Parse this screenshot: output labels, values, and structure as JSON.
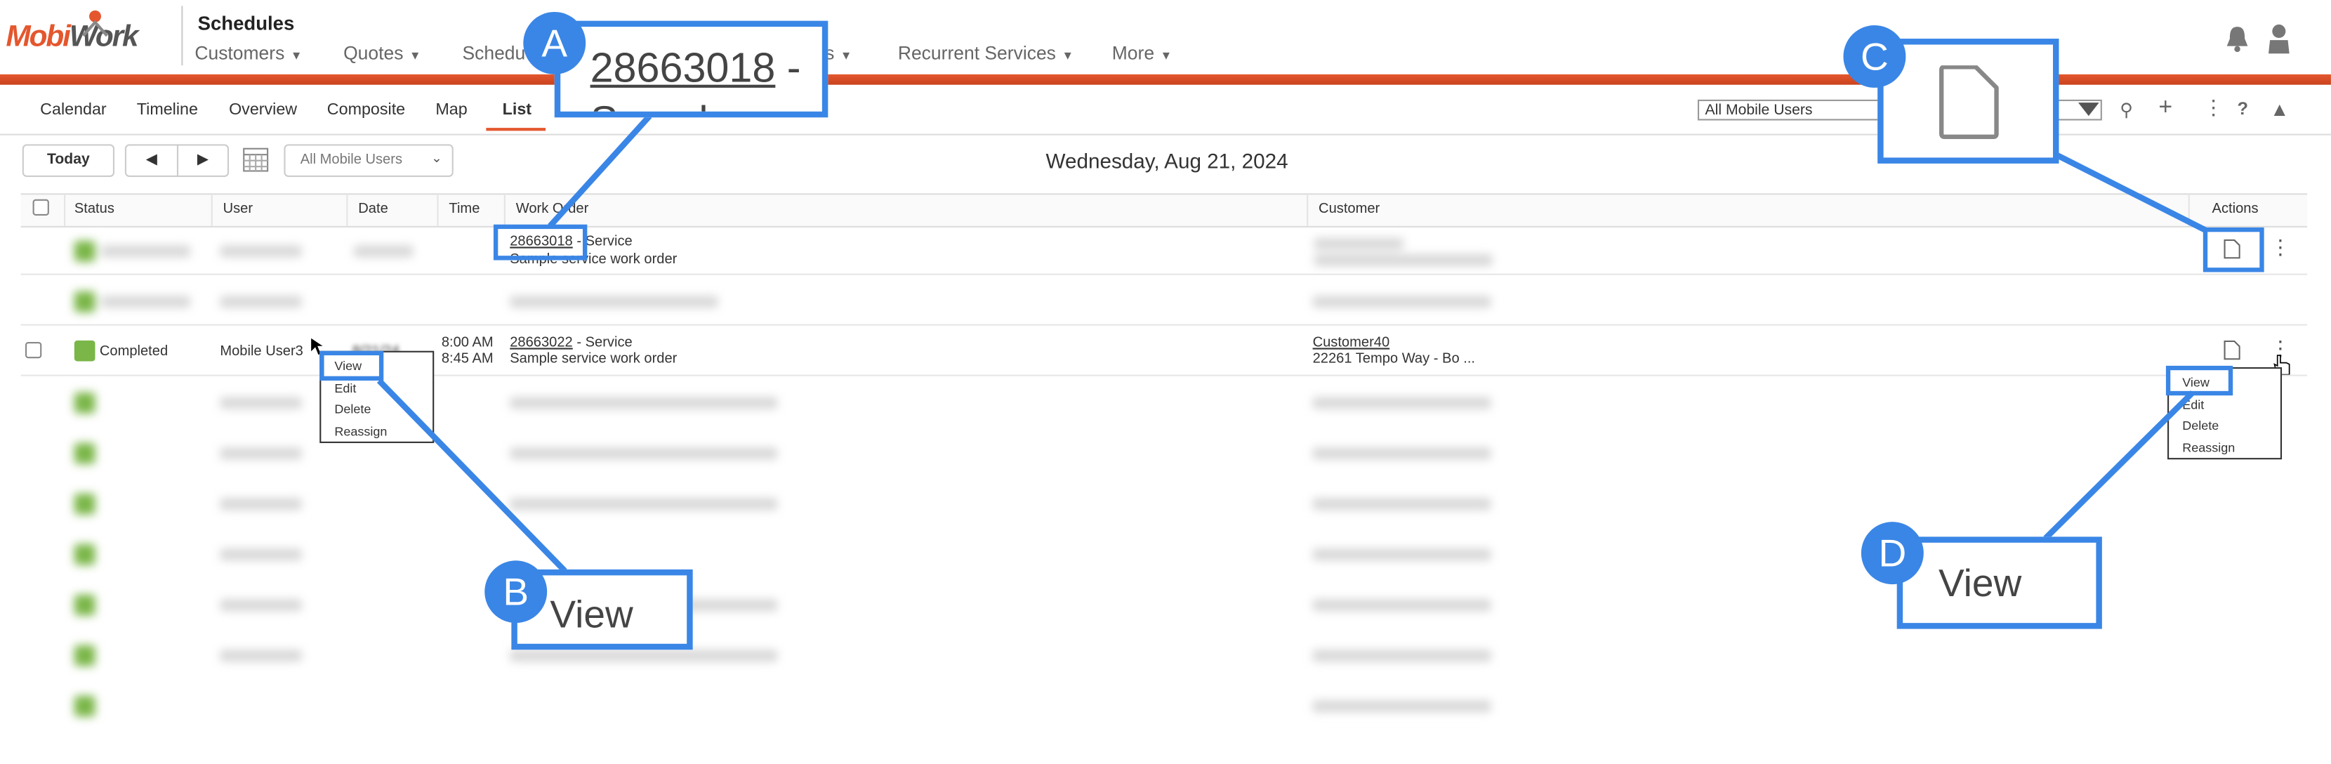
{
  "header": {
    "logo_text_1": "Mobi",
    "logo_text_2": "Work",
    "app_title": "Schedules",
    "nav": [
      "Customers",
      "Quotes",
      "Schedu",
      "s",
      "Recurrent Services",
      "More"
    ]
  },
  "subnav": {
    "tabs": [
      "Calendar",
      "Timeline",
      "Overview",
      "Composite",
      "Map",
      "List"
    ],
    "active_tab": "List",
    "user_select_value": "All Mobile Users"
  },
  "toolbar": {
    "today_label": "Today",
    "prev_label": "◀",
    "next_label": "▶",
    "user_filter_value": "All Mobile Users",
    "date_title": "Wednesday, Aug 21, 2024"
  },
  "table": {
    "headers": {
      "status": "Status",
      "user": "User",
      "date": "Date",
      "time": "Time",
      "work_order": "Work Order",
      "customer": "Customer",
      "actions": "Actions"
    },
    "row1": {
      "wo_number": "28663018",
      "wo_type": " - Service",
      "wo_desc": "Sample service work order"
    },
    "row2": {
      "status": "Completed",
      "user": "Mobile User3",
      "date_partial": "8/21/24",
      "time_start": "8:00 AM",
      "time_end": "8:45 AM",
      "wo_number": "28663022",
      "wo_type": " - Service",
      "wo_desc": "Sample service work order",
      "customer_name": "Customer40",
      "customer_address": "22261 Tempo Way  -  Bo ..."
    }
  },
  "menus": {
    "left": [
      "View",
      "Edit",
      "Delete",
      "Reassign"
    ],
    "right": [
      "View",
      "Edit",
      "Delete",
      "Reassign"
    ]
  },
  "callouts": {
    "a_badge": "A",
    "a_text": "28663018",
    "a_suffix": " -",
    "a_overflow": "Sample",
    "b_badge": "B",
    "b_text": "View",
    "c_badge": "C",
    "d_badge": "D",
    "d_text": "View"
  },
  "colors": {
    "accent_orange": "#e4572e",
    "highlight_blue": "#3a86e6",
    "status_green": "#7ab648"
  }
}
